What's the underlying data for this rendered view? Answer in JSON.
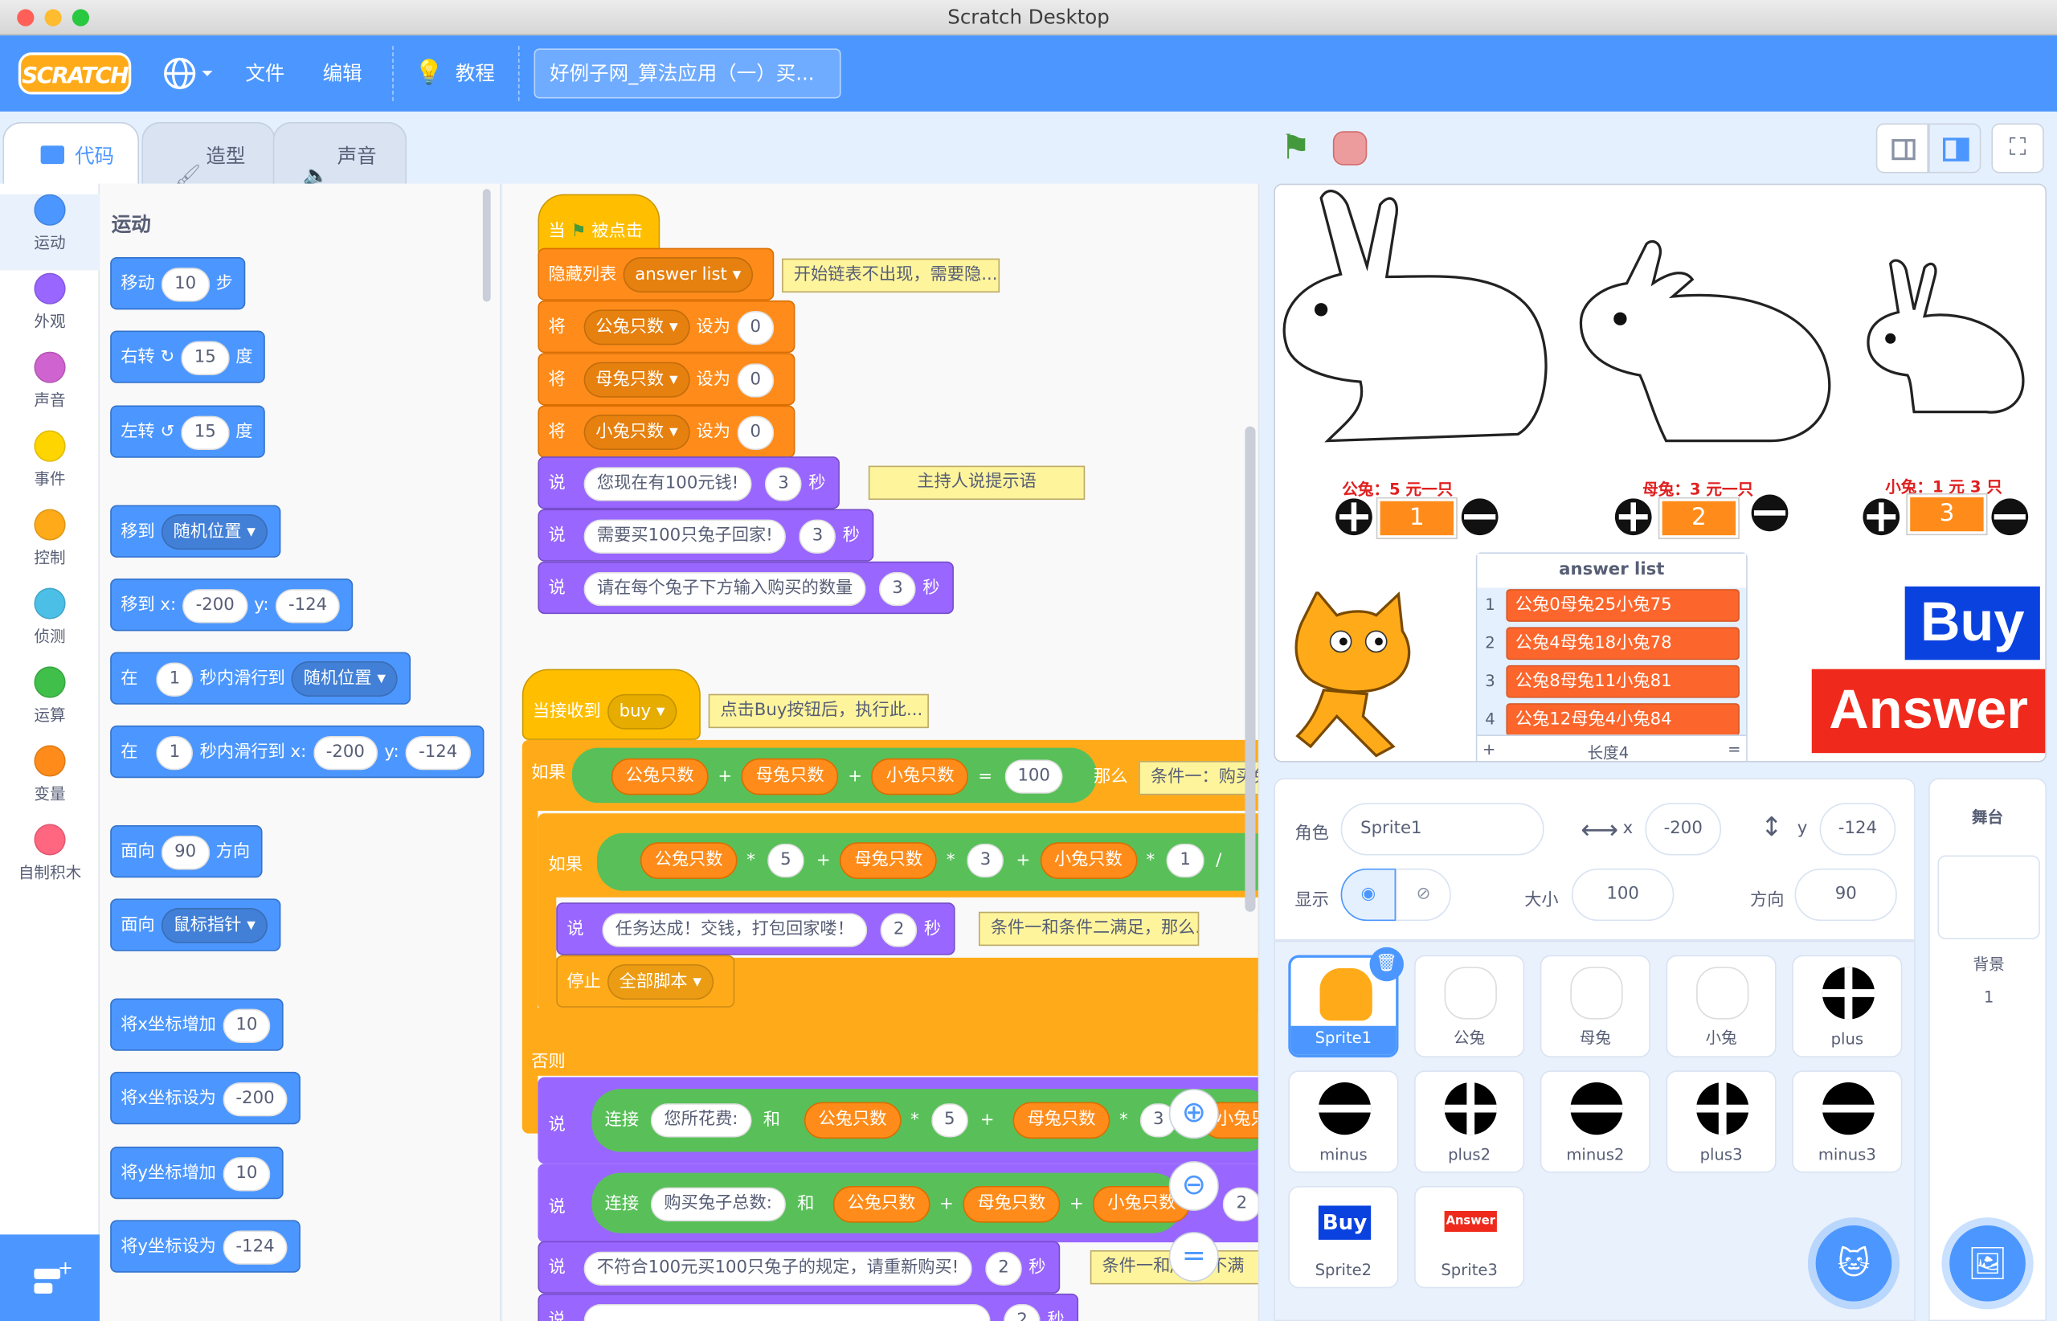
{
  "window": {
    "title": "Scratch Desktop"
  },
  "menubar": {
    "logo": "SCRATCH",
    "file": "文件",
    "edit": "编辑",
    "tutorials": "教程",
    "project_title": "好例子网_算法应用（一）买..."
  },
  "tabs": {
    "code": "代码",
    "costumes": "造型",
    "sounds": "声音"
  },
  "categories": [
    {
      "label": "运动",
      "color": "#4c97ff"
    },
    {
      "label": "外观",
      "color": "#9966ff"
    },
    {
      "label": "声音",
      "color": "#cf63cf"
    },
    {
      "label": "事件",
      "color": "#ffd500"
    },
    {
      "label": "控制",
      "color": "#ffab19"
    },
    {
      "label": "侦测",
      "color": "#4cbfe6"
    },
    {
      "label": "运算",
      "color": "#40bf4a"
    },
    {
      "label": "变量",
      "color": "#ff8c1a"
    },
    {
      "label": "自制积木",
      "color": "#ff6680"
    }
  ],
  "palette": {
    "heading": "运动",
    "move": {
      "pre": "移动",
      "v": "10",
      "post": "步"
    },
    "turn_right": {
      "pre": "右转",
      "v": "15",
      "post": "度"
    },
    "turn_left": {
      "pre": "左转",
      "v": "15",
      "post": "度"
    },
    "goto": {
      "pre": "移到",
      "dd": "随机位置"
    },
    "goto_xy": {
      "pre": "移到 x:",
      "x": "-200",
      "y_label": "y:",
      "y": "-124"
    },
    "glide": {
      "pre": "在",
      "v": "1",
      "mid": "秒内滑行到",
      "dd": "随机位置"
    },
    "glide_xy": {
      "pre": "在",
      "v": "1",
      "mid": "秒内滑行到 x:",
      "x": "-200",
      "y_label": "y:",
      "y": "-124"
    },
    "point_dir": {
      "pre": "面向",
      "v": "90",
      "post": "方向"
    },
    "point_towards": {
      "pre": "面向",
      "dd": "鼠标指针"
    },
    "change_x": {
      "pre": "将x坐标增加",
      "v": "10"
    },
    "set_x": {
      "pre": "将x坐标设为",
      "v": "-200"
    },
    "change_y": {
      "pre": "将y坐标增加",
      "v": "10"
    },
    "set_y": {
      "pre": "将y坐标设为",
      "v": "-124"
    }
  },
  "script1": {
    "hat": {
      "pre": "当",
      "post": "被点击"
    },
    "hide_list": {
      "pre": "隐藏列表",
      "dd": "answer list"
    },
    "comment1": "开始链表不出现，需要隐...",
    "set1": {
      "pre": "将",
      "var": "公兔只数",
      "mid": "设为",
      "v": "0"
    },
    "set2": {
      "pre": "将",
      "var": "母兔只数",
      "mid": "设为",
      "v": "0"
    },
    "set3": {
      "pre": "将",
      "var": "小兔只数",
      "mid": "设为",
      "v": "0"
    },
    "say1": {
      "pre": "说",
      "text": "您现在有100元钱!",
      "v": "3",
      "post": "秒"
    },
    "comment2": "主持人说提示语",
    "say2": {
      "pre": "说",
      "text": "需要买100只兔子回家!",
      "v": "3",
      "post": "秒"
    },
    "say3": {
      "pre": "说",
      "text": "请在每个兔子下方输入购买的数量",
      "v": "3",
      "post": "秒"
    }
  },
  "script2": {
    "hat": {
      "pre": "当接收到",
      "dd": "buy"
    },
    "comment3": "点击Buy按钮后，执行此...",
    "if1": {
      "pre": "如果",
      "a": "公兔只数",
      "b": "母兔只数",
      "c": "小兔只数",
      "plus": "+",
      "eq": "=",
      "v": "100",
      "post": "那么"
    },
    "comment4": "条件一：购买兔",
    "if2": {
      "pre": "如果",
      "a": "公兔只数",
      "m1": "5",
      "b": "母兔只数",
      "m2": "3",
      "c": "小兔只数",
      "m3": "1",
      "times": "*",
      "plus": "+",
      "div": "/"
    },
    "say_ok": {
      "pre": "说",
      "text": "任务达成！交钱，打包回家喽！",
      "v": "2",
      "post": "秒"
    },
    "comment5": "条件一和条件二满足，那么...",
    "stop": {
      "pre": "停止",
      "dd": "全部脚本"
    },
    "else": "否则",
    "say_cost": {
      "pre": "说",
      "join": "连接",
      "text": "您所花费:",
      "and": "和",
      "a": "公兔只数",
      "m1": "5",
      "b": "母兔只数",
      "m2": "3",
      "c": "小兔只"
    },
    "say_total": {
      "pre": "说",
      "join": "连接",
      "text": "购买兔子总数:",
      "and": "和",
      "a": "公兔只数",
      "b": "母兔只数",
      "c": "小兔只数",
      "v": "2",
      "post": "秒"
    },
    "say_rule": {
      "pre": "说",
      "text": "不符合100元买100只兔子的规定，请重新购买!",
      "v": "2",
      "post": "秒"
    },
    "comment6": "条件一和/或二不满",
    "say_last": {
      "pre": "说",
      "text": "",
      "v": "2",
      "post": "秒"
    }
  },
  "stage": {
    "prices": {
      "male": "公兔：5 元一只",
      "female": "母兔：3 元一只",
      "baby": "小兔：1 元 3 只"
    },
    "values": {
      "male": "1",
      "female": "2",
      "baby": "3"
    },
    "list": {
      "title": "answer list",
      "items": [
        "公兔0母兔25小兔75",
        "公兔4母兔18小兔78",
        "公兔8母兔11小兔81",
        "公兔12母兔4小兔84"
      ],
      "nums": [
        "1",
        "2",
        "3",
        "4"
      ],
      "plus": "+",
      "length": "长度4",
      "eq": "="
    },
    "buy": "Buy",
    "answer": "Answer"
  },
  "sprite_info": {
    "sprite_label": "角色",
    "sprite_name": "Sprite1",
    "x_label": "x",
    "x": "-200",
    "y_label": "y",
    "y": "-124",
    "show_label": "显示",
    "size_label": "大小",
    "size": "100",
    "dir_label": "方向",
    "dir": "90"
  },
  "sprites": [
    "Sprite1",
    "公兔",
    "母兔",
    "小兔",
    "plus",
    "minus",
    "plus2",
    "minus2",
    "plus3",
    "minus3",
    "Sprite2",
    "Sprite3"
  ],
  "sprite_thumbs": {
    "buy": "Buy",
    "answer": "Answer"
  },
  "stage_panel": {
    "title": "舞台",
    "backdrop_label": "背景",
    "backdrop_count": "1"
  }
}
